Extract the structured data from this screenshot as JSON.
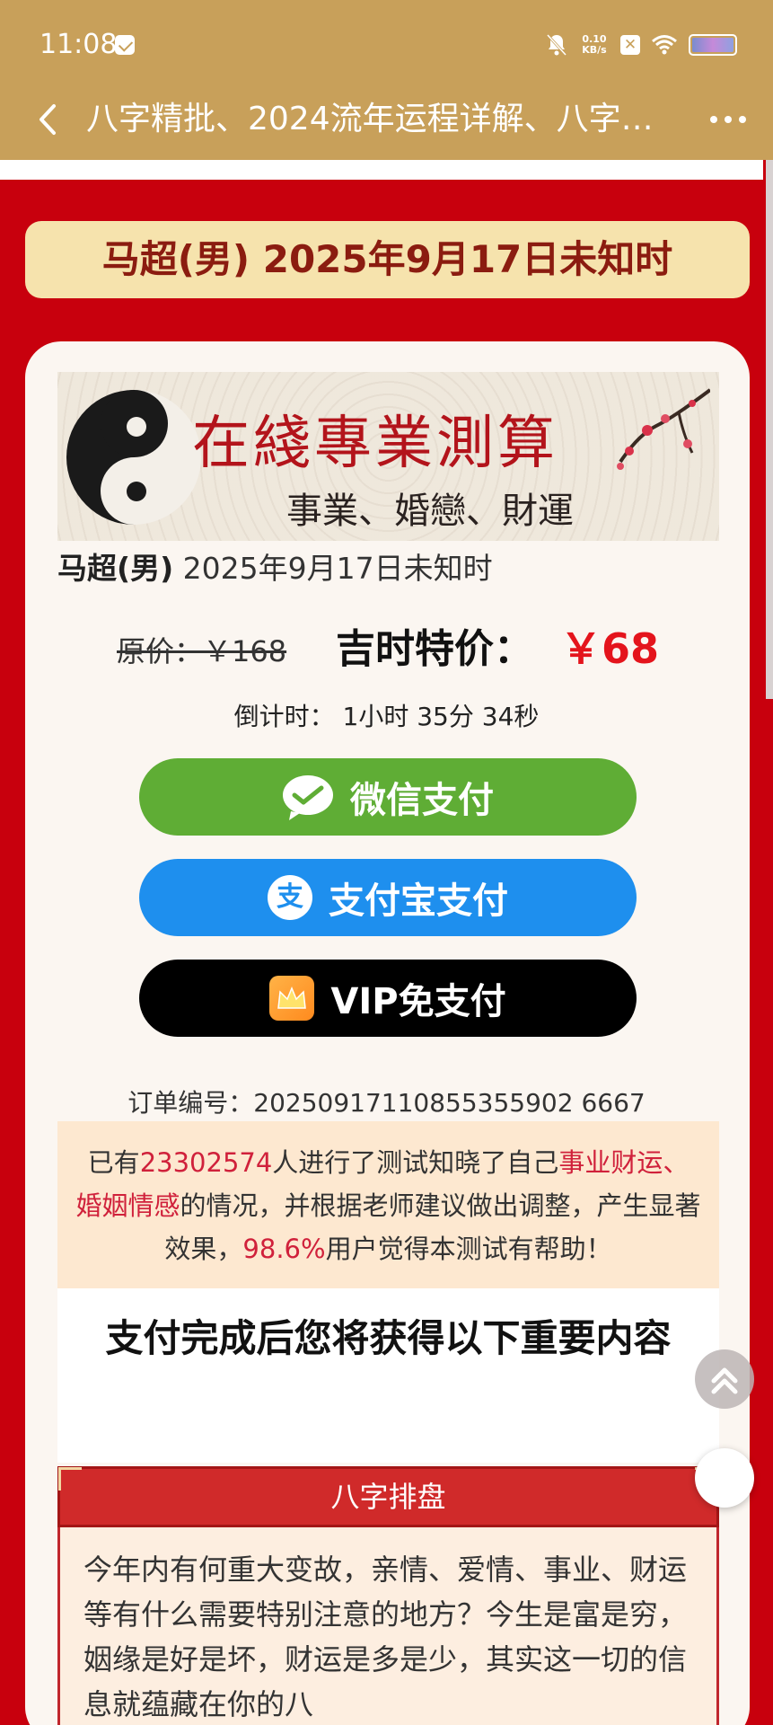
{
  "status_bar": {
    "time": "11:08",
    "net_speed_value": "0.10",
    "net_speed_unit": "KB/s",
    "x_badge": "✕"
  },
  "nav": {
    "title": "八字精批、2024流年运程详解、八字…"
  },
  "header": {
    "subject": "马超(男) 2025年9月17日未知时"
  },
  "banner": {
    "title": "在綫專業測算",
    "subtitle": "事業、婚戀、財運"
  },
  "subject_line": {
    "name": "马超(男)",
    "date": " 2025年9月17日未知时"
  },
  "pricing": {
    "original": "原价：￥168",
    "special_label": "吉时特价：",
    "special_value": "￥68"
  },
  "countdown": "倒计时： 1小时 35分 34秒",
  "payment": {
    "wechat": "微信支付",
    "alipay": "支付宝支付",
    "alipay_glyph": "支",
    "vip": "VIP免支付"
  },
  "order": "订单编号：20250917110855355902 6667",
  "stats": {
    "p1": "已有",
    "count": "23302574",
    "p2": "人进行了测试知晓了自己",
    "topics": "事业财运、婚姻情感",
    "p3": "的情况，并根据老师建议做出调整，产生显著效果，",
    "percent": "98.6%",
    "p4": "用户觉得本测试有帮助！"
  },
  "gain": {
    "title": "支付完成后您将获得以下重要内容"
  },
  "section": {
    "title": "八字排盘",
    "body": "今年内有何重大变故，亲情、爱情、事业、财运等有什么需要特别注意的地方？今生是富是穷，姻缘是好是坏，财运是多是少，其实这一切的信息就蕴藏在你的八"
  },
  "colors": {
    "brand_gold": "#c8a05a",
    "page_red": "#c8000d",
    "wechat_green": "#5fad35",
    "alipay_blue": "#1e8fee",
    "price_red": "#e4141c"
  }
}
